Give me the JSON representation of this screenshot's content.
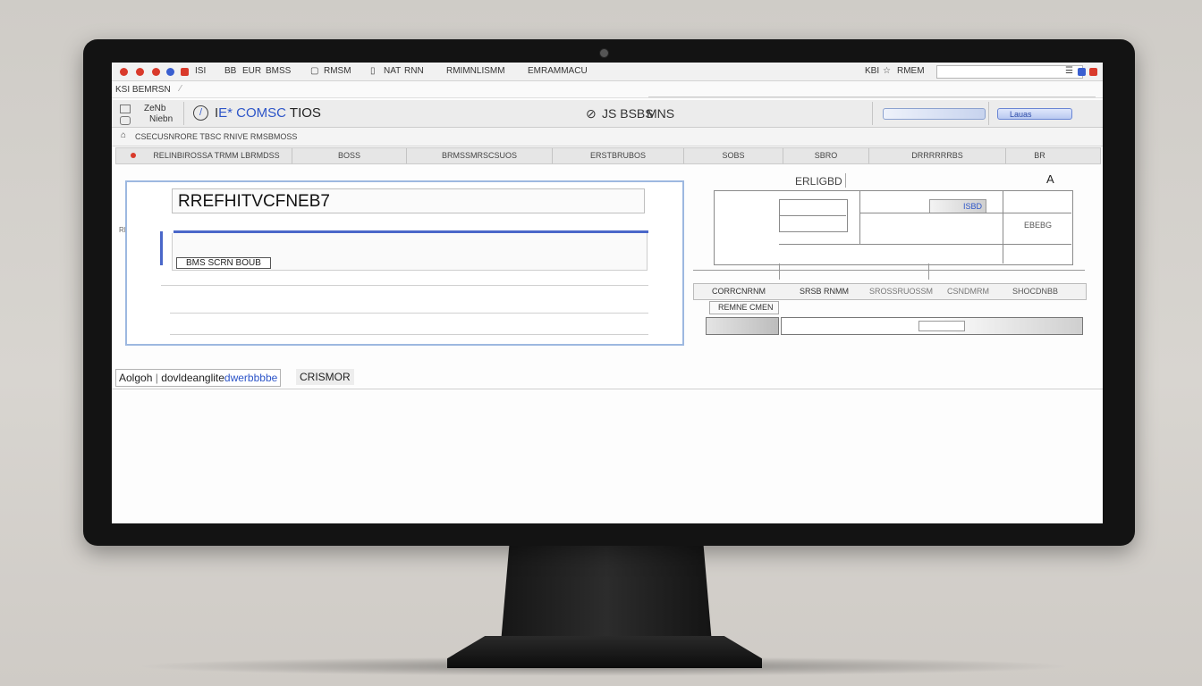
{
  "tabbar": {
    "tabs": [
      "ISI",
      "BB",
      "EUR",
      "BMSS",
      "RMSM",
      "NAT",
      "RNN",
      "RMIMNLISMM",
      "EMRAMMACU",
      "RMEM"
    ],
    "right_label": "KBI",
    "url_text": "",
    "accent_colors": [
      "#d93a2b",
      "#d93a2b",
      "#d93a2b",
      "#3a5fd0",
      "#d93a2b"
    ]
  },
  "crumb": {
    "label": "KSI BEMRSN"
  },
  "toolbar": {
    "left_top": "ZeNb",
    "left_bottom": "Niebn",
    "tool_icon": "info-icon",
    "title_prefix": "I",
    "title_blue": "E* COMSC",
    "title_suffix": "TIOS",
    "mid_icon": "settings-icon",
    "mid_label": "JS BSBS",
    "mid_suffix": "MNS",
    "right_button": "Lauas"
  },
  "infobar": {
    "text": "CSECUSNRORE TBSC RNIVE RMSBMOSS"
  },
  "columns": [
    "RELINBIROSSA TRMM LBRMDSS",
    "BOSS",
    "BRMSSMRSCSUOS",
    "ERSTBRUBOS",
    "SOBS",
    "SBRO",
    "DRRRRRRBS",
    "BR"
  ],
  "left_panel": {
    "hash_value": "RREFHITVCFNEB7",
    "chip_label": "BMS SCRN BOUB",
    "side_label": "REIPRMM"
  },
  "right_panel": {
    "header_label": "ERLIGBD",
    "corner_label": "A",
    "cell_blue": "ISBD",
    "cell_right": "EBEBG",
    "row_labels": [
      "CORRCNRNM",
      "SRSB RNMM",
      "SROSSRUOSSM",
      "CSNDMRM",
      "SHOCDNBB"
    ],
    "sub_label": "REMNE CMEN"
  },
  "search": {
    "prefix": "Aolgoh",
    "mid": "dovldeanglite",
    "highlight": "dwerbbbbe",
    "button": "CRISMOR"
  }
}
